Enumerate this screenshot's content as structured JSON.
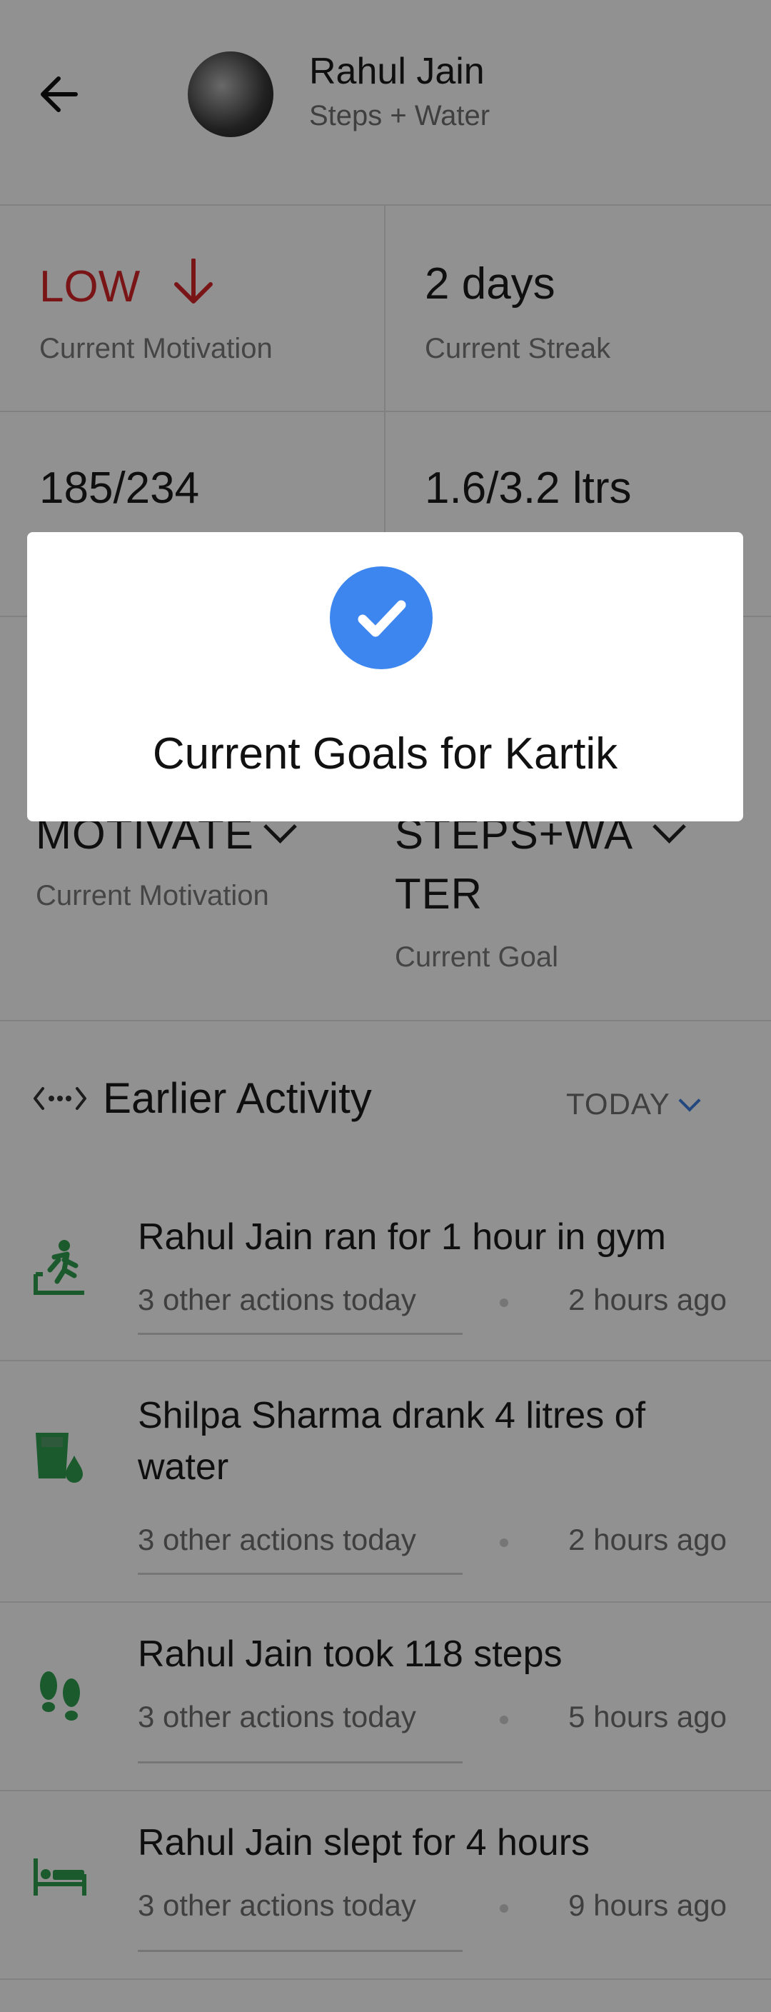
{
  "header": {
    "name": "Rahul Jain",
    "subtitle": "Steps + Water"
  },
  "stats": {
    "motivation_value": "LOW",
    "motivation_label": "Current Motivation",
    "streak_value": "2 days",
    "streak_label": "Current Streak",
    "steps_value": "185/234",
    "water_value": "1.6/3.2 ltrs"
  },
  "selectors": {
    "motivate_value": "MOTIVATE",
    "motivate_label": "Current Motivation",
    "goal_value_line1": "STEPS+WA",
    "goal_value_line2": "TER",
    "goal_label": "Current Goal"
  },
  "earlier_activity": {
    "title": "Earlier Activity",
    "filter": "TODAY"
  },
  "activities": [
    {
      "title": "Rahul Jain ran for 1 hour in gym",
      "others": "3 other actions today",
      "time": "2 hours ago",
      "icon": "running-icon"
    },
    {
      "title_line1": "Shilpa Sharma drank 4 litres of",
      "title_line2": "water",
      "others": "3 other actions today",
      "time": "2 hours ago",
      "icon": "water-glass-icon"
    },
    {
      "title": "Rahul Jain took 118 steps",
      "others": "3 other actions today",
      "time": "5 hours ago",
      "icon": "footsteps-icon"
    },
    {
      "title": "Rahul Jain slept for 4 hours",
      "others": "3 other actions today",
      "time": "9 hours ago",
      "icon": "bed-icon"
    }
  ],
  "dialog": {
    "title": "Current Goals for Kartik",
    "icon": "check-circle-icon"
  },
  "colors": {
    "low": "#d6262a",
    "accent_blue": "#3d86f0",
    "activity_green": "#2e9e4f",
    "overlay": "rgba(0,0,0,0.43)"
  }
}
